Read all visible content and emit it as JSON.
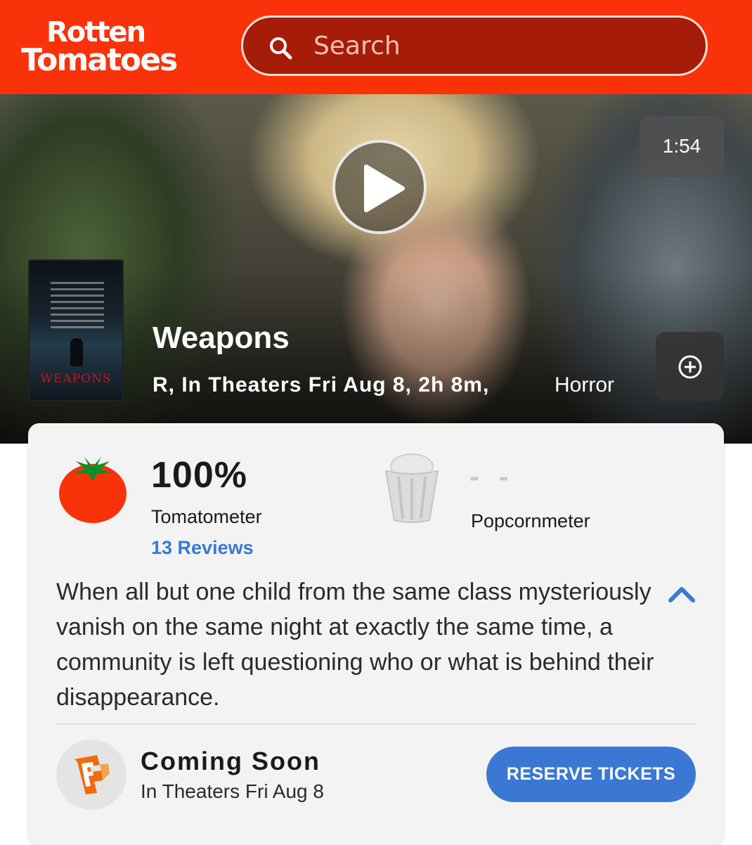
{
  "header": {
    "logo_line1": "Rotten",
    "logo_line2": "Tomatoes",
    "brand_color": "#fa320a",
    "search": {
      "placeholder": "Search",
      "icon": "search-icon"
    }
  },
  "hero": {
    "video_duration": "1:54",
    "play_icon": "play-icon",
    "add_icon": "add-circle-icon",
    "poster_title": "WEAPONS",
    "movie_title": "Weapons",
    "meta": "R, In Theaters Fri Aug 8, 2h 8m,",
    "genre": "Horror"
  },
  "scores": {
    "tomatometer": {
      "value": "100%",
      "label": "Tomatometer",
      "reviews": "13 Reviews",
      "icon": "tomato-icon"
    },
    "popcornmeter": {
      "value": "- -",
      "label": "Popcornmeter",
      "icon": "popcorn-icon"
    }
  },
  "synopsis": "When all but one child from the same class mysteriously vanish on the same night at exactly the same time, a community is left questioning who or what is behind their disappearance.",
  "tickets": {
    "status": "Coming Soon",
    "release": "In Theaters Fri Aug 8",
    "button": "RESERVE TICKETS",
    "button_color": "#3a78d4",
    "vendor_icon": "fandango-icon"
  }
}
